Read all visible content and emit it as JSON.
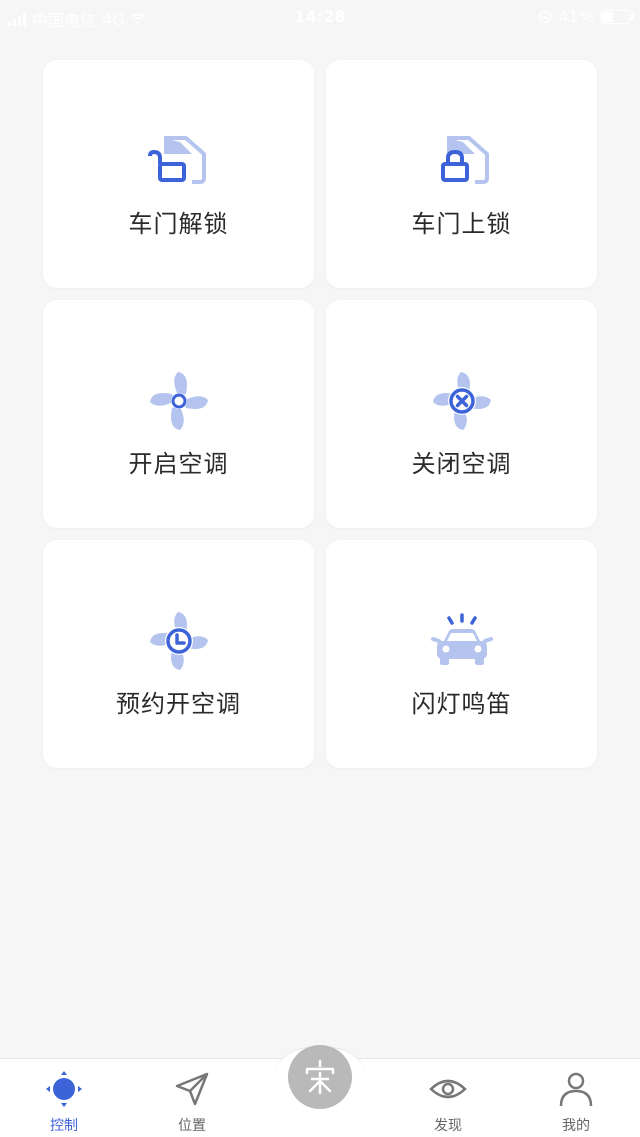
{
  "status_bar": {
    "carrier": "中国电信",
    "network": "4G",
    "time": "14:28",
    "battery": "41%",
    "battery_level": 0.41
  },
  "controls": [
    {
      "name": "door-unlock",
      "label": "车门解锁",
      "icon": "door-unlock-icon"
    },
    {
      "name": "door-lock",
      "label": "车门上锁",
      "icon": "door-lock-icon"
    },
    {
      "name": "ac-on",
      "label": "开启空调",
      "icon": "fan-on-icon"
    },
    {
      "name": "ac-off",
      "label": "关闭空调",
      "icon": "fan-off-icon"
    },
    {
      "name": "ac-schedule",
      "label": "预约开空调",
      "icon": "fan-clock-icon"
    },
    {
      "name": "flash-horn",
      "label": "闪灯鸣笛",
      "icon": "car-flash-icon"
    }
  ],
  "tabs": [
    {
      "label": "控制",
      "icon": "control-icon",
      "active": true
    },
    {
      "label": "位置",
      "icon": "location-arrow-icon",
      "active": false
    },
    {
      "label": "发现",
      "icon": "eye-icon",
      "active": false
    },
    {
      "label": "我的",
      "icon": "user-icon",
      "active": false
    }
  ],
  "center_button": {
    "glyph": "宋",
    "icon": "brand-logo-icon"
  },
  "colors": {
    "accent": "#3d63d8",
    "icon_light": "#b4c4ee",
    "background": "#f6f6f7",
    "card": "#ffffff"
  }
}
